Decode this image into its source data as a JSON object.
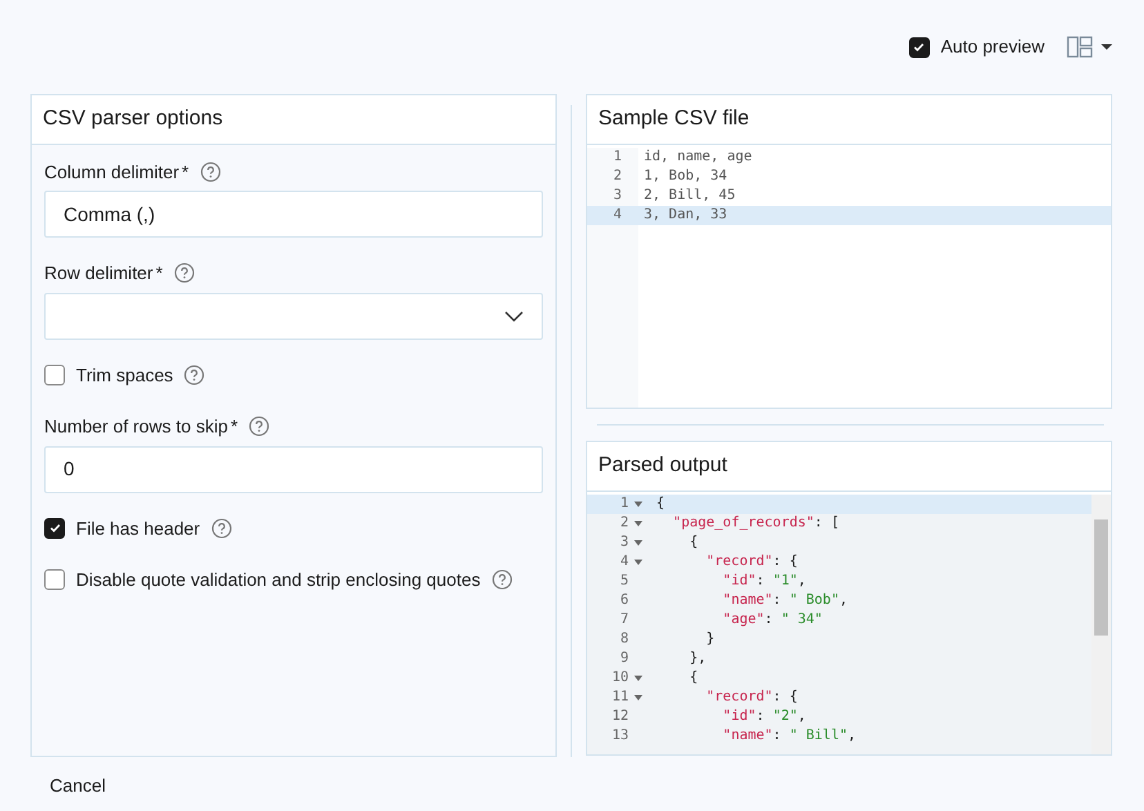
{
  "toolbar": {
    "auto_preview": {
      "label": "Auto preview",
      "checked": true
    }
  },
  "options_panel": {
    "title": "CSV parser options",
    "fields": [
      {
        "kind": "text",
        "label": "Column delimiter",
        "required_mark": "*",
        "value": "Comma (,)"
      },
      {
        "kind": "select",
        "label": "Row delimiter",
        "required_mark": "*"
      },
      {
        "kind": "checkbox",
        "label": "Trim spaces",
        "checked": false
      },
      {
        "kind": "text",
        "label": "Number of rows to skip",
        "required_mark": "*",
        "value": "0"
      },
      {
        "kind": "checkbox",
        "label": "File has header",
        "checked": true
      },
      {
        "kind": "checkbox",
        "label": "Disable quote validation and strip enclosing quotes",
        "checked": false
      }
    ]
  },
  "sample_panel": {
    "title": "Sample CSV file",
    "lines": [
      {
        "number": "1",
        "text": "id, name, age",
        "active": false
      },
      {
        "number": "2",
        "text": "1, Bob, 34",
        "active": false
      },
      {
        "number": "3",
        "text": "2, Bill, 45",
        "active": false
      },
      {
        "number": "4",
        "text": "3, Dan, 33",
        "active": true
      }
    ]
  },
  "output_panel": {
    "title": "Parsed output",
    "lines": [
      {
        "number": "1",
        "text": "{",
        "foldable": true,
        "active": true
      },
      {
        "number": "2",
        "text": "  \"page_of_records\": [",
        "foldable": true,
        "active": false
      },
      {
        "number": "3",
        "text": "    {",
        "foldable": true,
        "active": false
      },
      {
        "number": "4",
        "text": "      \"record\": {",
        "foldable": true,
        "active": false
      },
      {
        "number": "5",
        "text": "        \"id\": \"1\",",
        "foldable": false,
        "active": false
      },
      {
        "number": "6",
        "text": "        \"name\": \" Bob\",",
        "foldable": false,
        "active": false
      },
      {
        "number": "7",
        "text": "        \"age\": \" 34\"",
        "foldable": false,
        "active": false
      },
      {
        "number": "8",
        "text": "      }",
        "foldable": false,
        "active": false
      },
      {
        "number": "9",
        "text": "    },",
        "foldable": false,
        "active": false
      },
      {
        "number": "10",
        "text": "    {",
        "foldable": true,
        "active": false
      },
      {
        "number": "11",
        "text": "      \"record\": {",
        "foldable": true,
        "active": false
      },
      {
        "number": "12",
        "text": "        \"id\": \"2\",",
        "foldable": false,
        "active": false
      },
      {
        "number": "13",
        "text": "        \"name\": \" Bill\",",
        "foldable": false,
        "active": false
      }
    ]
  },
  "footer": {
    "cancel": "Cancel"
  }
}
